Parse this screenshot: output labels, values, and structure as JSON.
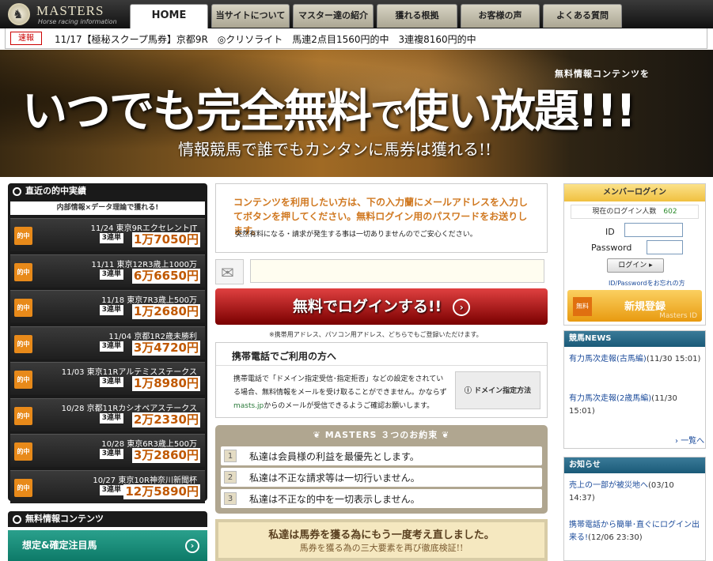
{
  "header": {
    "logo_title": "MASTERS",
    "logo_sub": "Horse racing information",
    "logo_icon": "horse-emblem-icon",
    "nav": [
      "HOME",
      "当サイトについて",
      "マスター達の紹介",
      "獲れる根拠",
      "お客様の声",
      "よくある質問"
    ]
  },
  "newsbar": {
    "badge": "速報",
    "text": "11/17【極秘スクープ馬券】京都9R　◎クリソライト　馬連2点目1560円的中　3連複8160円的中"
  },
  "banner": {
    "sub1": "無料情報コンテンツを",
    "main_a": "いつでも完全無料",
    "main_b": "で",
    "main_c": "使い放題!!!",
    "sub2": "情報競馬で誰でもカンタンに馬券は獲れる!!"
  },
  "hits": {
    "title": "直近の的中実績",
    "subtitle": "内部情報×データ理論で獲れる!",
    "badge": "的中",
    "items": [
      {
        "desc": "11/24 東京9RエクセレントJT",
        "type": "3連単",
        "amount": "1万7050円"
      },
      {
        "desc": "11/11 東京12R3歳上1000万",
        "type": "3連単",
        "amount": "6万6650円"
      },
      {
        "desc": "11/18 東京7R3歳上500万",
        "type": "3連単",
        "amount": "1万2680円"
      },
      {
        "desc": "11/04 京都1R2歳未勝利",
        "type": "3連単",
        "amount": "3万4720円"
      },
      {
        "desc": "11/03 東京11Rアルテミスステークス",
        "type": "3連単",
        "amount": "1万8980円"
      },
      {
        "desc": "10/28 京都11Rカシオペアステークス",
        "type": "3連単",
        "amount": "2万2330円"
      },
      {
        "desc": "10/28 東京6R3歳上500万",
        "type": "3連単",
        "amount": "3万2860円"
      },
      {
        "desc": "10/27 東京10R神奈川新聞杯",
        "type": "3連単",
        "amount": "12万5890円"
      }
    ]
  },
  "free": {
    "title": "無料情報コンテンツ",
    "item": "想定&確定注目馬"
  },
  "center": {
    "message": "コンテンツを利用したい方は、下の入力蘭にメールアドレスを入力してボタンを押してください。無料ログイン用のパスワードをお送りします。",
    "note": "突然有料になる・請求が発生する事は一切ありませんのでご安心ください。",
    "email_placeholder": "",
    "login_button": "無料でログインする!!",
    "login_note": "※携帯用アドレス、パソコン用アドレス、どちらでもご登録いただけます。",
    "mobile_title": "携帯電話でご利用の方へ",
    "mobile_text_a": "携帯電話で「ドメイン指定受信･指定拒否」などの設定をされている場合、無料情報をメールを受け取ることができません。かならず",
    "mobile_link": "masts.jp",
    "mobile_text_b": "からのメールが受信できるようご確認お願いします。",
    "domain_button": "ドメイン指定方法"
  },
  "promise": {
    "title": "MASTERS ３つのお約束",
    "items": [
      {
        "num": "1",
        "text": "私達は会員様の利益を最優先とします。"
      },
      {
        "num": "2",
        "text": "私達は不正な請求等は一切行いません。"
      },
      {
        "num": "3",
        "text": "私達は不正な的中を一切表示しません。"
      }
    ]
  },
  "think": {
    "line1": "私達は馬券を獲る為にもう一度考え直しました。",
    "line2": "馬券を獲る為の三大要素を再び徹底検証!!"
  },
  "member": {
    "title": "メンバーログイン",
    "count_label": "現在のログイン人数",
    "count": "602",
    "id_label": "ID",
    "pw_label": "Password",
    "login": "ログイン ▸",
    "forgot": "ID/Passwordをお忘れの方",
    "reg_mark": "無料",
    "reg_label": "新規登録",
    "reg_sig": "Masters ID"
  },
  "racenews": {
    "title": "競馬NEWS",
    "items": [
      {
        "text": "有力馬次走報(古馬編)",
        "date": "(11/30 15:01)"
      },
      {
        "text": "有力馬次走報(2歳馬編)",
        "date": "(11/30 15:01)"
      }
    ],
    "more": "一覧へ"
  },
  "info": {
    "title": "お知らせ",
    "items": [
      {
        "text": "売上の一部が被災地へ",
        "date": "(03/10 14:37)"
      },
      {
        "text": "携帯電話から簡単･直ぐにログイン出来る!",
        "date": "(12/06 23:30)"
      }
    ]
  },
  "colors": {
    "accent": "#e88a1a",
    "login_red": "#c01818",
    "teal": "#1a5a78"
  }
}
